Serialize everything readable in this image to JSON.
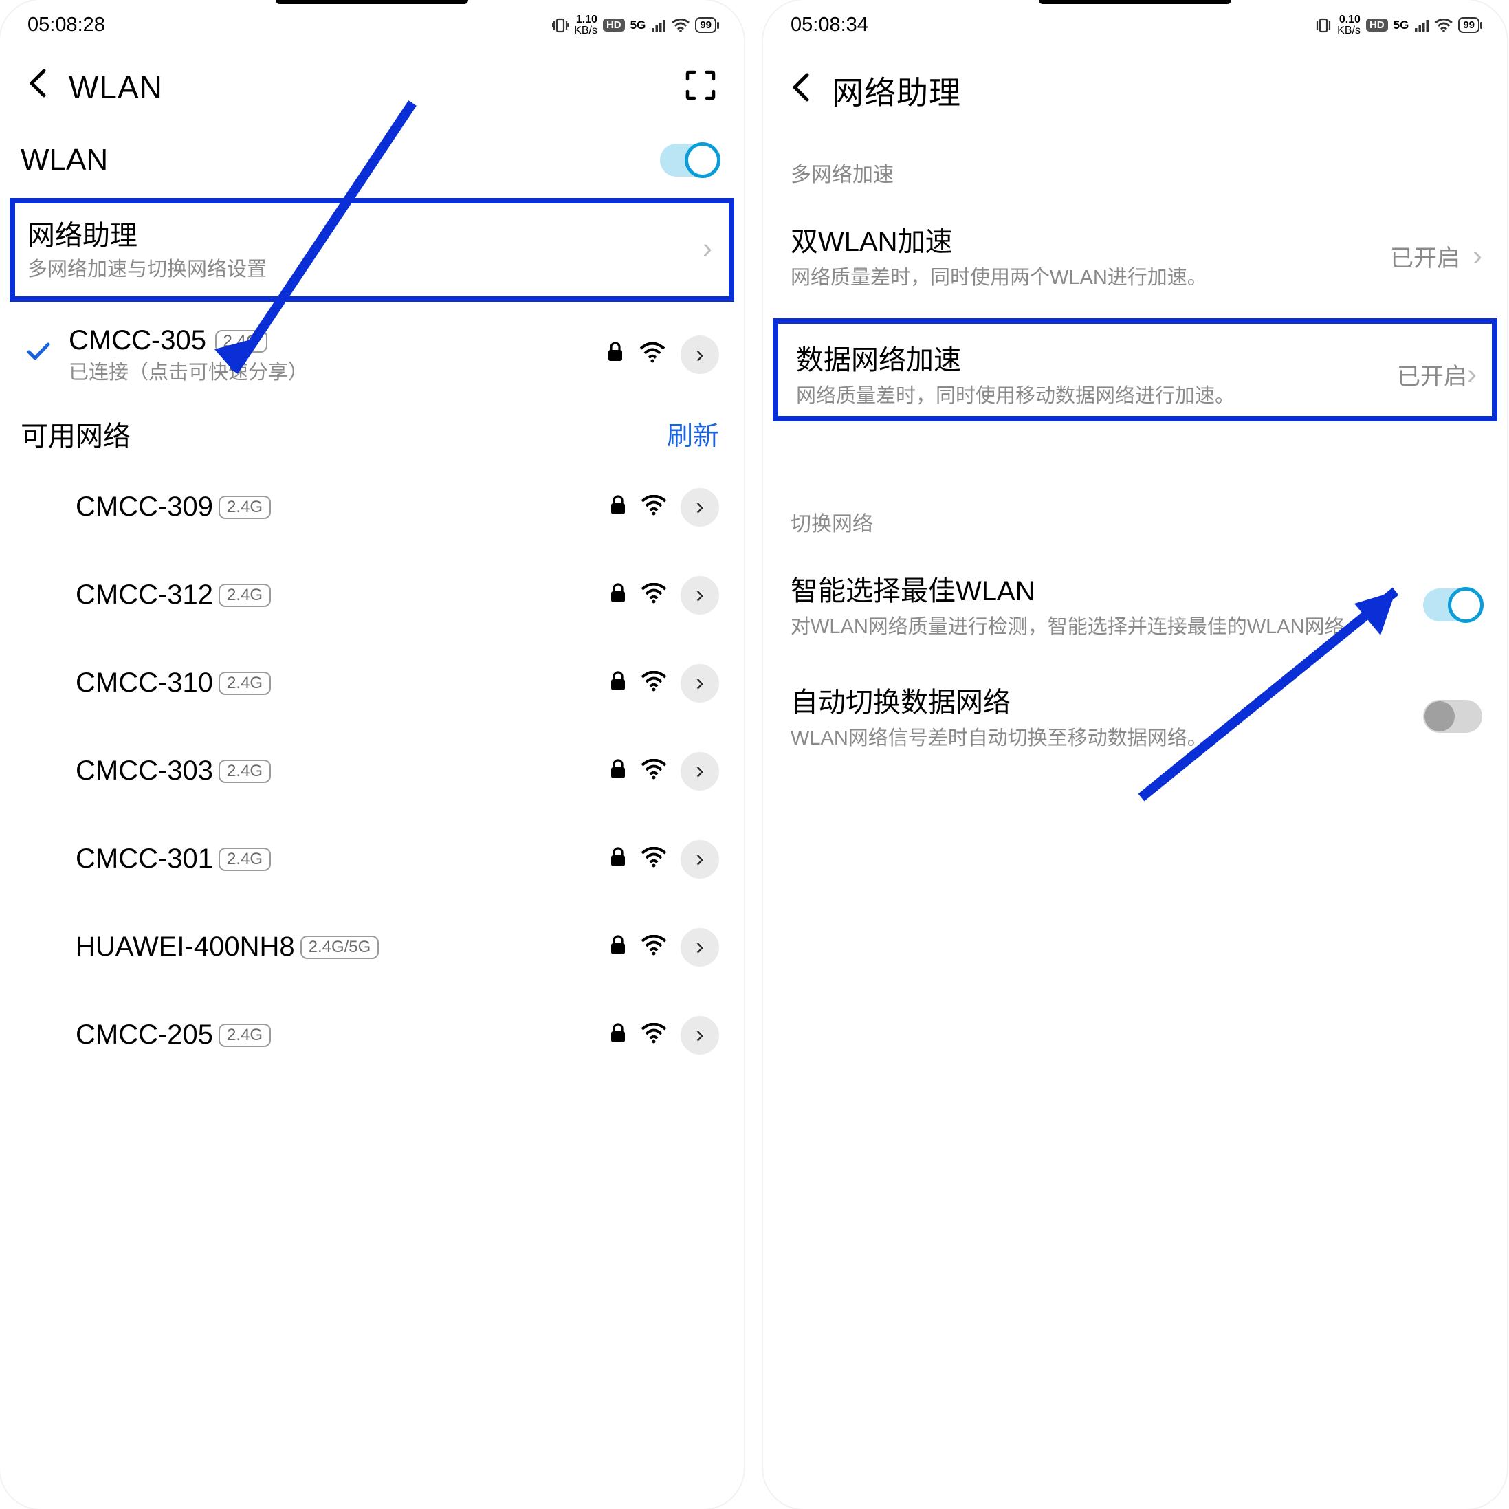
{
  "left": {
    "status": {
      "time": "05:08:28",
      "speed_top": "1.10",
      "speed_unit": "KB/s",
      "hd": "HD",
      "net": "5G",
      "battery": "99"
    },
    "header": {
      "title": "WLAN"
    },
    "wlan_label": "WLAN",
    "assistant": {
      "title": "网络助理",
      "sub": "多网络加速与切换网络设置"
    },
    "connected": {
      "name": "CMCC-305",
      "band": "2.4G",
      "sub": "已连接（点击可快速分享）"
    },
    "available_header": "可用网络",
    "refresh": "刷新",
    "networks": [
      {
        "name": "CMCC-309",
        "band": "2.4G"
      },
      {
        "name": "CMCC-312",
        "band": "2.4G"
      },
      {
        "name": "CMCC-310",
        "band": "2.4G"
      },
      {
        "name": "CMCC-303",
        "band": "2.4G"
      },
      {
        "name": "CMCC-301",
        "band": "2.4G"
      },
      {
        "name": "HUAWEI-400NH8",
        "band": "2.4G/5G"
      },
      {
        "name": "CMCC-205",
        "band": "2.4G"
      }
    ]
  },
  "right": {
    "status": {
      "time": "05:08:34",
      "speed_top": "0.10",
      "speed_unit": "KB/s",
      "hd": "HD",
      "net": "5G",
      "battery": "99"
    },
    "header": {
      "title": "网络助理"
    },
    "group1": "多网络加速",
    "dual_wlan": {
      "title": "双WLAN加速",
      "sub": "网络质量差时，同时使用两个WLAN进行加速。",
      "status": "已开启"
    },
    "data_accel": {
      "title": "数据网络加速",
      "sub": "网络质量差时，同时使用移动数据网络进行加速。",
      "status": "已开启"
    },
    "group2": "切换网络",
    "smart_wlan": {
      "title": "智能选择最佳WLAN",
      "sub": "对WLAN网络质量进行检测，智能选择并连接最佳的WLAN网络。"
    },
    "auto_switch": {
      "title": "自动切换数据网络",
      "sub": "WLAN网络信号差时自动切换至移动数据网络。"
    }
  }
}
